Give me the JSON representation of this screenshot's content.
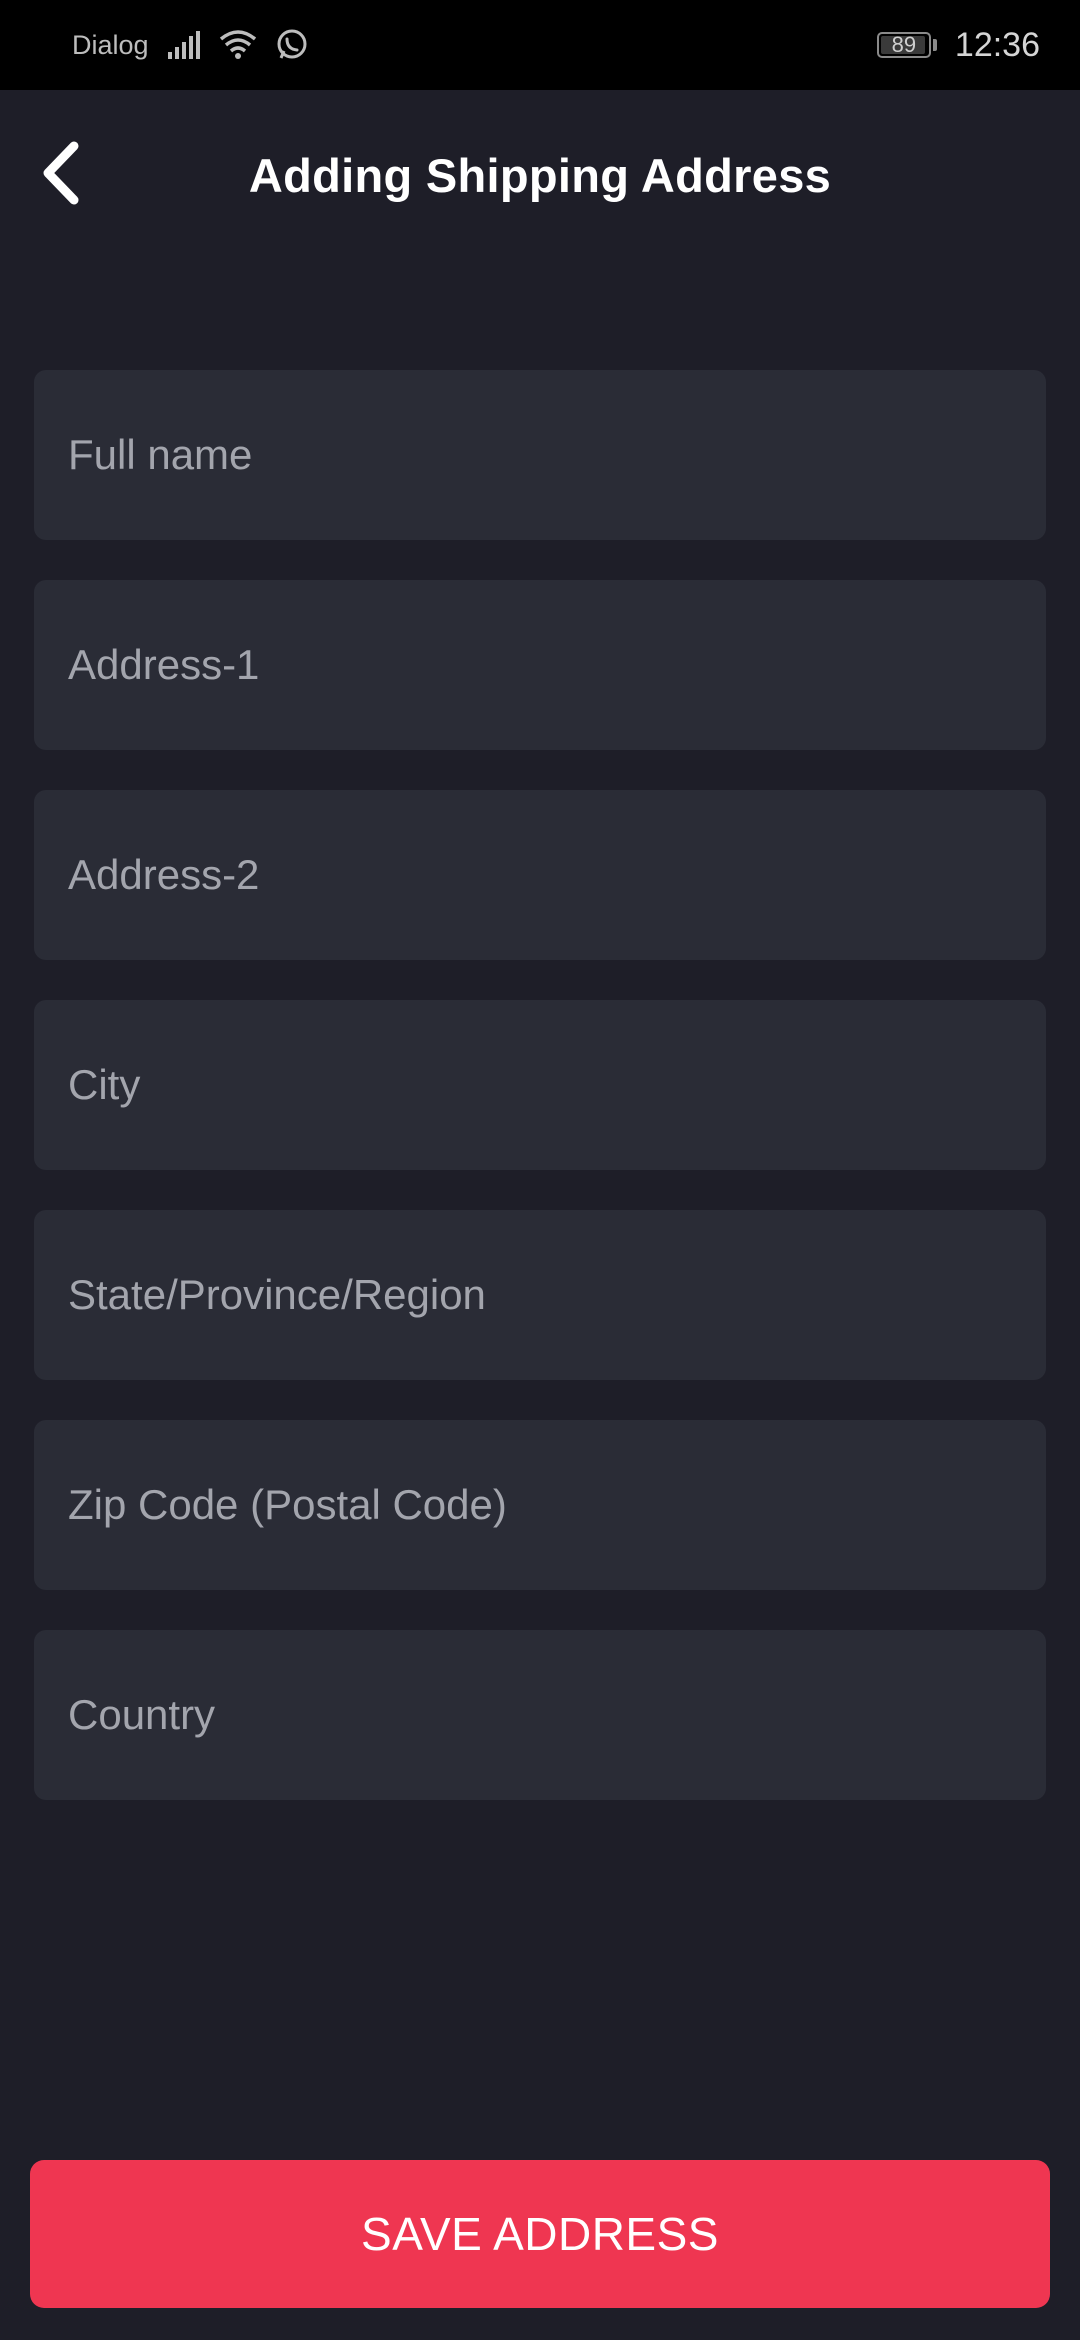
{
  "status_bar": {
    "carrier": "Dialog",
    "battery_level": "89",
    "time": "12:36",
    "icons": [
      "signal-icon",
      "wifi-icon",
      "whatsapp-icon",
      "battery-icon"
    ]
  },
  "header": {
    "back_icon": "chevron-left-icon",
    "title": "Adding Shipping Address"
  },
  "form": {
    "fields": [
      {
        "placeholder": "Full name",
        "value": ""
      },
      {
        "placeholder": "Address-1",
        "value": ""
      },
      {
        "placeholder": "Address-2",
        "value": ""
      },
      {
        "placeholder": "City",
        "value": ""
      },
      {
        "placeholder": "State/Province/Region",
        "value": ""
      },
      {
        "placeholder": "Zip Code (Postal Code)",
        "value": ""
      },
      {
        "placeholder": "Country",
        "value": ""
      }
    ]
  },
  "actions": {
    "save_label": "SAVE ADDRESS"
  },
  "colors": {
    "background": "#1e1e28",
    "field_background": "#2a2c36",
    "accent": "#ef3651",
    "placeholder": "#a3a5ad"
  }
}
